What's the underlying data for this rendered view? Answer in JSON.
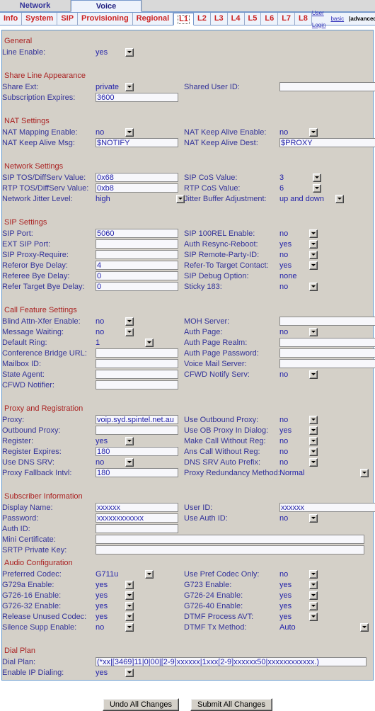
{
  "top_tabs": [
    {
      "label": "Network",
      "active": false
    },
    {
      "label": "Voice",
      "active": true
    }
  ],
  "sub_tabs": [
    {
      "label": "Info",
      "active": false
    },
    {
      "label": "System",
      "active": false
    },
    {
      "label": "SIP",
      "active": false
    },
    {
      "label": "Provisioning",
      "active": false
    },
    {
      "label": "Regional",
      "active": false
    },
    {
      "label": "L1",
      "active": true
    },
    {
      "label": "L2",
      "active": false
    },
    {
      "label": "L3",
      "active": false
    },
    {
      "label": "L4",
      "active": false
    },
    {
      "label": "L5",
      "active": false
    },
    {
      "label": "L6",
      "active": false
    },
    {
      "label": "L7",
      "active": false
    },
    {
      "label": "L8",
      "active": false
    }
  ],
  "corner_links": {
    "user_login": "User Login",
    "basic": "basic",
    "separator": "|",
    "advanced": "advanced"
  },
  "sections": {
    "general": {
      "title": "General",
      "line_enable_label": "Line Enable:",
      "line_enable_value": "yes"
    },
    "share_line": {
      "title": "Share Line Appearance",
      "share_ext_label": "Share Ext:",
      "share_ext_value": "private",
      "shared_user_id_label": "Shared User ID:",
      "shared_user_id_value": "",
      "subscription_expires_label": "Subscription Expires:",
      "subscription_expires_value": "3600"
    },
    "nat": {
      "title": "NAT Settings",
      "nat_mapping_enable_label": "NAT Mapping Enable:",
      "nat_mapping_enable_value": "no",
      "nat_keep_alive_enable_label": "NAT Keep Alive Enable:",
      "nat_keep_alive_enable_value": "no",
      "nat_keep_alive_msg_label": "NAT Keep Alive Msg:",
      "nat_keep_alive_msg_value": "$NOTIFY",
      "nat_keep_alive_dest_label": "NAT Keep Alive Dest:",
      "nat_keep_alive_dest_value": "$PROXY"
    },
    "network": {
      "title": "Network Settings",
      "sip_tos_label": "SIP TOS/DiffServ Value:",
      "sip_tos_value": "0x68",
      "sip_cos_label": "SIP CoS Value:",
      "sip_cos_value": "3",
      "rtp_tos_label": "RTP TOS/DiffServ Value:",
      "rtp_tos_value": "0xb8",
      "rtp_cos_label": "RTP CoS Value:",
      "rtp_cos_value": "6",
      "jitter_level_label": "Network Jitter Level:",
      "jitter_level_value": "high",
      "jitter_buffer_label": "Jitter Buffer Adjustment:",
      "jitter_buffer_value": "up and down"
    },
    "sip": {
      "title": "SIP Settings",
      "sip_port_label": "SIP Port:",
      "sip_port_value": "5060",
      "sip_100rel_label": "SIP 100REL Enable:",
      "sip_100rel_value": "no",
      "ext_sip_port_label": "EXT SIP Port:",
      "ext_sip_port_value": "",
      "auth_resync_label": "Auth Resync-Reboot:",
      "auth_resync_value": "yes",
      "sip_proxy_require_label": "SIP Proxy-Require:",
      "sip_proxy_require_value": "",
      "sip_remote_party_label": "SIP Remote-Party-ID:",
      "sip_remote_party_value": "no",
      "referor_bye_label": "Referor Bye Delay:",
      "referor_bye_value": "4",
      "refer_to_target_label": "Refer-To Target Contact:",
      "refer_to_target_value": "yes",
      "referee_bye_label": "Referee Bye Delay:",
      "referee_bye_value": "0",
      "sip_debug_label": "SIP Debug Option:",
      "sip_debug_value": "none",
      "refer_target_bye_label": "Refer Target Bye Delay:",
      "refer_target_bye_value": "0",
      "sticky_183_label": "Sticky 183:",
      "sticky_183_value": "no"
    },
    "call_feature": {
      "title": "Call Feature Settings",
      "blind_attn_xfer_label": "Blind Attn-Xfer Enable:",
      "blind_attn_xfer_value": "no",
      "moh_server_label": "MOH Server:",
      "moh_server_value": "",
      "message_waiting_label": "Message Waiting:",
      "message_waiting_value": "no",
      "auth_page_label": "Auth Page:",
      "auth_page_value": "no",
      "default_ring_label": "Default Ring:",
      "default_ring_value": "1",
      "auth_page_realm_label": "Auth Page Realm:",
      "auth_page_realm_value": "",
      "conference_bridge_label": "Conference Bridge URL:",
      "conference_bridge_value": "",
      "auth_page_password_label": "Auth Page Password:",
      "auth_page_password_value": "",
      "mailbox_id_label": "Mailbox ID:",
      "mailbox_id_value": "",
      "voice_mail_server_label": "Voice Mail Server:",
      "voice_mail_server_value": "",
      "state_agent_label": "State Agent:",
      "state_agent_value": "",
      "cfwd_notify_serv_label": "CFWD Notify Serv:",
      "cfwd_notify_serv_value": "no",
      "cfwd_notifier_label": "CFWD Notifier:",
      "cfwd_notifier_value": ""
    },
    "proxy": {
      "title": "Proxy and Registration",
      "proxy_label": "Proxy:",
      "proxy_value": "voip.syd.spintel.net.au",
      "use_outbound_proxy_label": "Use Outbound Proxy:",
      "use_outbound_proxy_value": "no",
      "outbound_proxy_label": "Outbound Proxy:",
      "outbound_proxy_value": "",
      "use_ob_proxy_label": "Use OB Proxy In Dialog:",
      "use_ob_proxy_value": "yes",
      "register_label": "Register:",
      "register_value": "yes",
      "make_call_without_reg_label": "Make Call Without Reg:",
      "make_call_without_reg_value": "no",
      "register_expires_label": "Register Expires:",
      "register_expires_value": "180",
      "ans_call_without_reg_label": "Ans Call Without Reg:",
      "ans_call_without_reg_value": "no",
      "use_dns_srv_label": "Use DNS SRV:",
      "use_dns_srv_value": "no",
      "dns_srv_auto_prefix_label": "DNS SRV Auto Prefix:",
      "dns_srv_auto_prefix_value": "no",
      "proxy_fallback_label": "Proxy Fallback Intvl:",
      "proxy_fallback_value": "180",
      "proxy_redundancy_label": "Proxy Redundancy Method:",
      "proxy_redundancy_value": "Normal"
    },
    "subscriber": {
      "title": "Subscriber Information",
      "display_name_label": "Display Name:",
      "display_name_value": "xxxxxx",
      "user_id_label": "User ID:",
      "user_id_value": "xxxxxx",
      "password_label": "Password:",
      "password_value": "xxxxxxxxxxxx",
      "use_auth_id_label": "Use Auth ID:",
      "use_auth_id_value": "no",
      "auth_id_label": "Auth ID:",
      "auth_id_value": "",
      "mini_certificate_label": "Mini Certificate:",
      "mini_certificate_value": "",
      "srtp_private_key_label": "SRTP Private Key:",
      "srtp_private_key_value": ""
    },
    "audio": {
      "title": "Audio Configuration",
      "preferred_codec_label": "Preferred Codec:",
      "preferred_codec_value": "G711u",
      "use_pref_codec_only_label": "Use Pref Codec Only:",
      "use_pref_codec_only_value": "no",
      "g729a_label": "G729a Enable:",
      "g729a_value": "yes",
      "g723_label": "G723 Enable:",
      "g723_value": "yes",
      "g726_16_label": "G726-16 Enable:",
      "g726_16_value": "yes",
      "g726_24_label": "G726-24 Enable:",
      "g726_24_value": "yes",
      "g726_32_label": "G726-32 Enable:",
      "g726_32_value": "yes",
      "g726_40_label": "G726-40 Enable:",
      "g726_40_value": "yes",
      "release_unused_label": "Release Unused Codec:",
      "release_unused_value": "yes",
      "dtmf_process_avt_label": "DTMF Process AVT:",
      "dtmf_process_avt_value": "yes",
      "silence_supp_label": "Silence Supp Enable:",
      "silence_supp_value": "no",
      "dtmf_tx_method_label": "DTMF Tx Method:",
      "dtmf_tx_method_value": "Auto"
    },
    "dial_plan": {
      "title": "Dial Plan",
      "dial_plan_label": "Dial Plan:",
      "dial_plan_value": "(*xx|[3469]11|0|00|[2-9]xxxxxx|1xxx[2-9]xxxxxx50|xxxxxxxxxxxx.)",
      "enable_ip_dialing_label": "Enable IP Dialing:",
      "enable_ip_dialing_value": "yes"
    }
  },
  "buttons": {
    "undo": "Undo All Changes",
    "submit": "Submit All Changes"
  }
}
